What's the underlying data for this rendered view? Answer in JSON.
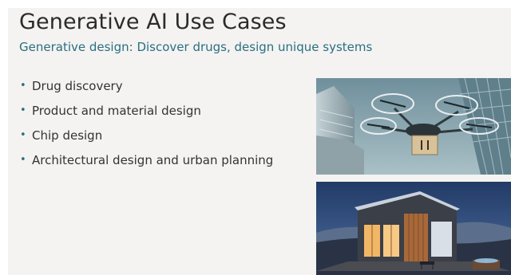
{
  "slide": {
    "title": "Generative AI Use Cases",
    "subtitle": "Generative design: Discover drugs, design unique systems",
    "bullets": [
      "Drug discovery",
      "Product and material design",
      "Chip design",
      "Architectural design and urban planning"
    ]
  },
  "colors": {
    "background": "#f4f3f1",
    "title": "#2b2b2b",
    "subtitle": "#2a6f81",
    "bullet_marker": "#2a6f81"
  },
  "icons": {
    "bullet": "bullet-dot-icon"
  }
}
